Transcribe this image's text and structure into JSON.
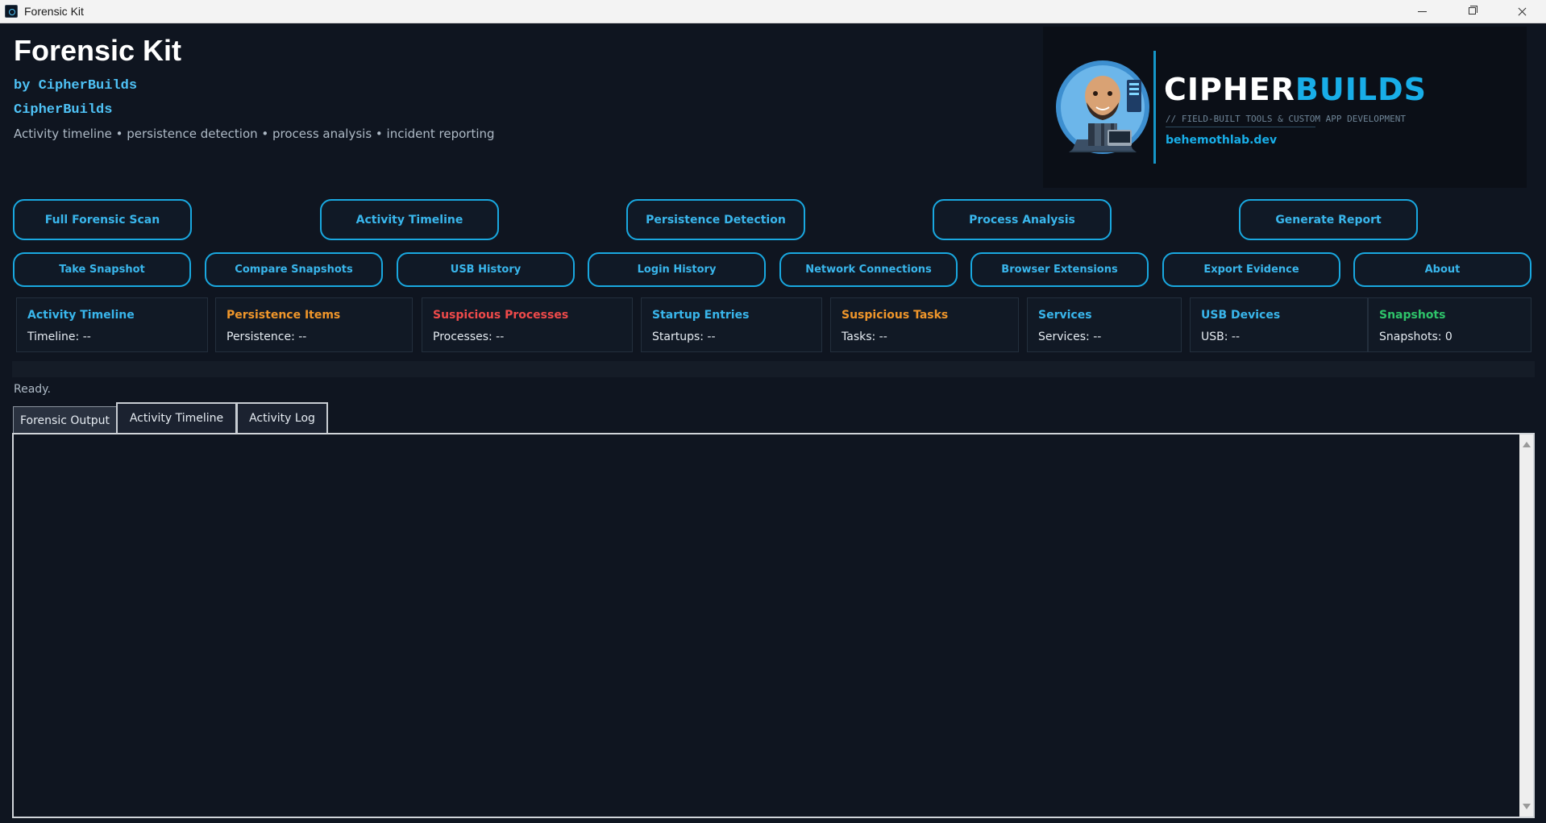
{
  "window": {
    "title": "Forensic Kit"
  },
  "header": {
    "title": "Forensic Kit",
    "byline": "by CipherBuilds",
    "brand": "CipherBuilds",
    "features": "Activity timeline  •  persistence detection  •  process analysis  •  incident reporting"
  },
  "banner": {
    "name_part1": "CIPHER",
    "name_part2": "BUILDS",
    "tagline": "// FIELD-BUILT TOOLS & CUSTOM APP DEVELOPMENT",
    "url": "behemothlab.dev"
  },
  "actions_row1": [
    "Full Forensic Scan",
    "Activity Timeline",
    "Persistence Detection",
    "Process Analysis",
    "Generate Report"
  ],
  "actions_row2": [
    "Take Snapshot",
    "Compare Snapshots",
    "USB History",
    "Login History",
    "Network Connections",
    "Browser Extensions",
    "Export Evidence",
    "About"
  ],
  "cards": [
    {
      "title": "Activity Timeline",
      "value": "Timeline: --",
      "color": "#39b6ec"
    },
    {
      "title": "Persistence Items",
      "value": "Persistence: --",
      "color": "#f0962a"
    },
    {
      "title": "Suspicious Processes",
      "value": "Processes: --",
      "color": "#ef4a4a"
    },
    {
      "title": "Startup Entries",
      "value": "Startups: --",
      "color": "#39b6ec"
    },
    {
      "title": "Suspicious Tasks",
      "value": "Tasks: --",
      "color": "#f0962a"
    },
    {
      "title": "Services",
      "value": "Services: --",
      "color": "#39b6ec"
    },
    {
      "title": "USB Devices",
      "value": "USB: --",
      "color": "#39b6ec"
    },
    {
      "title": "Snapshots",
      "value": "Snapshots: 0",
      "color": "#2ec46a"
    }
  ],
  "status": "Ready.",
  "tabs": [
    "Forensic Output",
    "Activity Timeline",
    "Activity Log"
  ],
  "colors": {
    "accent": "#19a8e0",
    "background": "#0f1520",
    "panel": "#111925"
  },
  "icons": {
    "app": "app-icon",
    "avatar": "avatar-illustration"
  }
}
